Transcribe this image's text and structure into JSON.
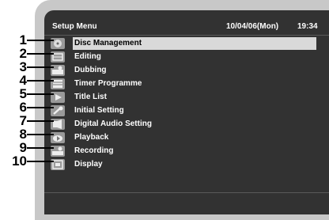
{
  "header": {
    "title": "Setup Menu",
    "date": "10/04/06(Mon)",
    "time": "19:34"
  },
  "menu": [
    {
      "num": "1",
      "label": "Disc Management",
      "icon": "disc-icon",
      "selected": true
    },
    {
      "num": "2",
      "label": "Editing",
      "icon": "edit-icon"
    },
    {
      "num": "3",
      "label": "Dubbing",
      "icon": "dubbing-icon"
    },
    {
      "num": "4",
      "label": "Timer Programme",
      "icon": "timer-icon"
    },
    {
      "num": "5",
      "label": "Title List",
      "icon": "play-icon"
    },
    {
      "num": "6",
      "label": "Initial Setting",
      "icon": "wrench-icon"
    },
    {
      "num": "7",
      "label": "Digital Audio Setting",
      "icon": "audio-icon"
    },
    {
      "num": "8",
      "label": "Playback",
      "icon": "playback-icon"
    },
    {
      "num": "9",
      "label": "Recording",
      "icon": "record-icon"
    },
    {
      "num": "10",
      "label": "Display",
      "icon": "display-icon"
    }
  ]
}
